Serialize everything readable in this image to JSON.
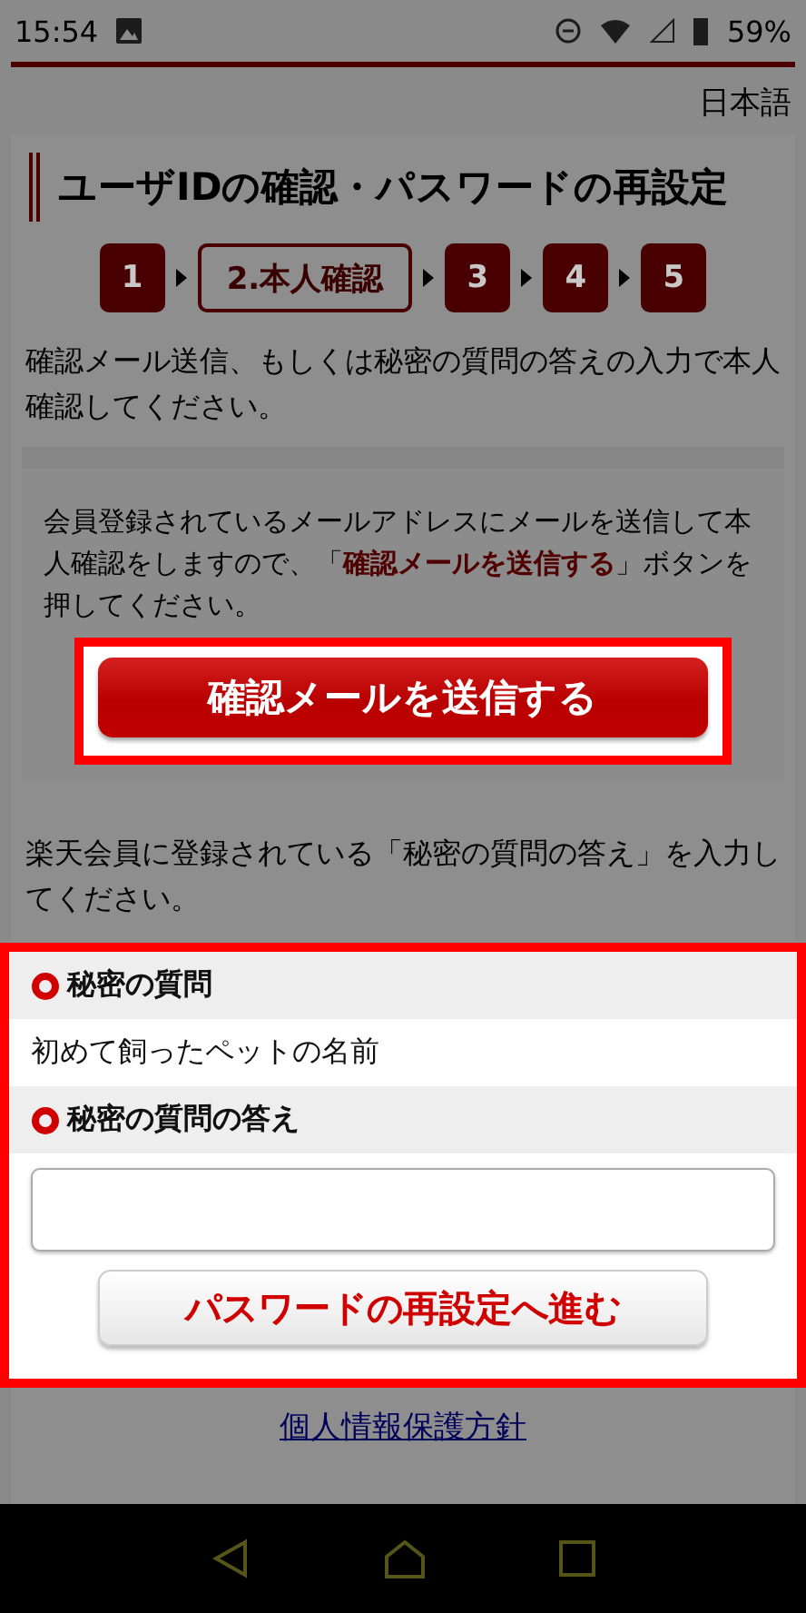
{
  "status_bar": {
    "time": "15:54",
    "battery": "59%"
  },
  "language": "日本語",
  "title": "ユーザIDの確認・パスワードの再設定",
  "steps": [
    {
      "label": "1",
      "selected": false
    },
    {
      "label": "2.本人確認",
      "selected": true
    },
    {
      "label": "3",
      "selected": false
    },
    {
      "label": "4",
      "selected": false
    },
    {
      "label": "5",
      "selected": false
    }
  ],
  "intro": "確認メール送信、もしくは秘密の質問の答えの入力で本人確認してください。",
  "email_section": {
    "text": "会員登録されているメールアドレスにメールを送信して本人確認をしますので、「**確認メールを送信する**」ボタンを押してください。",
    "button": "確認メールを送信する",
    "highlighted": true
  },
  "question_intro": "楽天会員に登録されている「秘密の質問の答え」を入力してください。",
  "question_form": {
    "highlighted": true,
    "question_label": "秘密の質問",
    "question": "初めて飼ったペットの名前",
    "answer_label": "秘密の質問の答え",
    "button": "パスワードの再設定へ進む"
  },
  "footer_link": "個人情報保護方針"
}
